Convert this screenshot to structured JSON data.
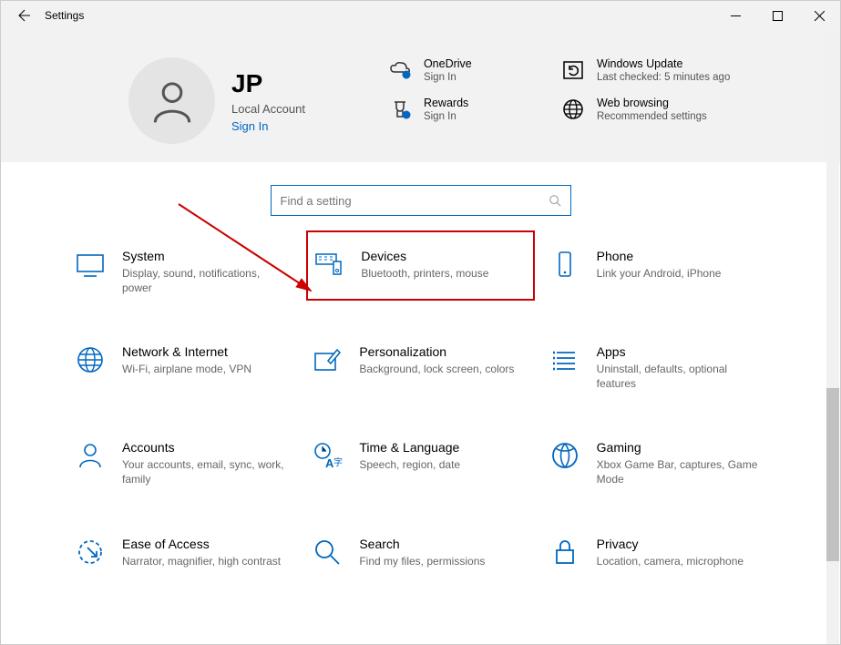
{
  "window": {
    "title": "Settings"
  },
  "profile": {
    "name": "JP",
    "account_type": "Local Account",
    "signin_label": "Sign In"
  },
  "header_tiles": {
    "onedrive": {
      "label": "OneDrive",
      "sub": "Sign In"
    },
    "update": {
      "label": "Windows Update",
      "sub": "Last checked: 5 minutes ago"
    },
    "rewards": {
      "label": "Rewards",
      "sub": "Sign In"
    },
    "web": {
      "label": "Web browsing",
      "sub": "Recommended settings"
    }
  },
  "search": {
    "placeholder": "Find a setting"
  },
  "categories": [
    {
      "id": "system",
      "title": "System",
      "sub": "Display, sound, notifications, power"
    },
    {
      "id": "devices",
      "title": "Devices",
      "sub": "Bluetooth, printers, mouse",
      "highlighted": true
    },
    {
      "id": "phone",
      "title": "Phone",
      "sub": "Link your Android, iPhone"
    },
    {
      "id": "network",
      "title": "Network & Internet",
      "sub": "Wi-Fi, airplane mode, VPN"
    },
    {
      "id": "personalization",
      "title": "Personalization",
      "sub": "Background, lock screen, colors"
    },
    {
      "id": "apps",
      "title": "Apps",
      "sub": "Uninstall, defaults, optional features"
    },
    {
      "id": "accounts",
      "title": "Accounts",
      "sub": "Your accounts, email, sync, work, family"
    },
    {
      "id": "time",
      "title": "Time & Language",
      "sub": "Speech, region, date"
    },
    {
      "id": "gaming",
      "title": "Gaming",
      "sub": "Xbox Game Bar, captures, Game Mode"
    },
    {
      "id": "ease",
      "title": "Ease of Access",
      "sub": "Narrator, magnifier, high contrast"
    },
    {
      "id": "searchcat",
      "title": "Search",
      "sub": "Find my files, permissions"
    },
    {
      "id": "privacy",
      "title": "Privacy",
      "sub": "Location, camera, microphone"
    }
  ]
}
